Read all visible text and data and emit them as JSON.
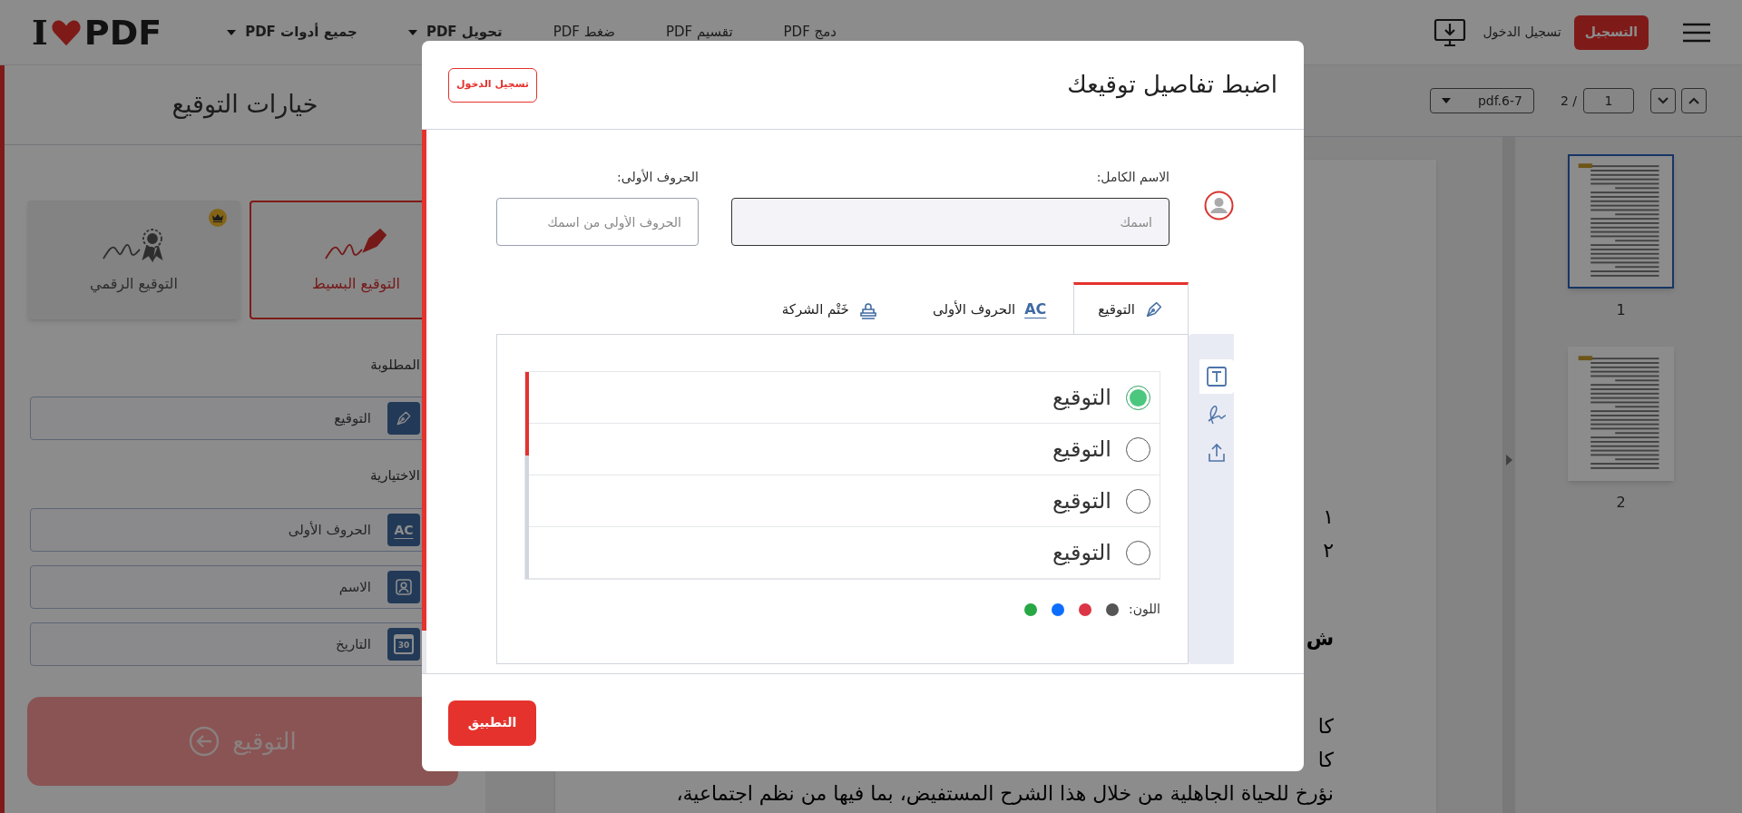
{
  "navbar": {
    "logo": {
      "letter": "I",
      "word": "PDF"
    },
    "nav_items": [
      {
        "label": "دمج PDF",
        "dropdown": false
      },
      {
        "label": "تقسيم PDF",
        "dropdown": false
      },
      {
        "label": "ضغط PDF",
        "dropdown": false
      },
      {
        "label": "تحويل PDF",
        "dropdown": true
      },
      {
        "label": "جميع أدوات PDF",
        "dropdown": true
      }
    ],
    "login": "تسجيل الدخول",
    "signup": "التسجيل"
  },
  "sidebar": {
    "title": "خيارات التوقيع",
    "types": [
      {
        "label": "التوقيع البسيط",
        "kind": "simple",
        "selected": true
      },
      {
        "label": "التوقيع الرقمي",
        "kind": "digital",
        "selected": false
      }
    ],
    "required_heading": "المطلوبة",
    "required_fields": [
      {
        "label": "التوقيع",
        "kind": "pen"
      }
    ],
    "optional_heading": "الاختيارية",
    "optional_fields": [
      {
        "label": "الحروف الأولى",
        "kind": "initials",
        "icon_text": "AC"
      },
      {
        "label": "الاسم",
        "kind": "person"
      },
      {
        "label": "التاريخ",
        "kind": "calendar",
        "icon_text": "30"
      }
    ],
    "sign_button": "التوقيع"
  },
  "viewer": {
    "file": "pdf.6-7",
    "page": "1",
    "page_count": "2 /",
    "document_lines": [
      {
        "text": "١",
        "bold": false
      },
      {
        "text": "٢",
        "bold": false
      },
      {
        "text": "ش",
        "bold": true
      },
      {
        "text": "كا",
        "bold": false
      },
      {
        "text": "كا",
        "bold": false
      },
      {
        "text": "نؤرخ للحياة الجاهلية من خلال هذا الشرح المستفيض، بما فيها من نظم اجتماعية،",
        "bold": false
      }
    ],
    "thumbnails": [
      {
        "label": "1",
        "selected": true
      },
      {
        "label": "2",
        "selected": false
      }
    ]
  },
  "modal": {
    "title": "اضبط تفاصيل توقيعك",
    "login_button": "تسجيل الدخول",
    "full_name": {
      "label": "الاسم الكامل:",
      "placeholder": "اسمك"
    },
    "initials": {
      "label": "الحروف الأولى:",
      "placeholder": "الحروف الأولى من اسمك"
    },
    "tabs": [
      {
        "label": "التوقيع",
        "kind": "pen",
        "selected": true
      },
      {
        "label": "الحروف الأولى",
        "kind": "initials",
        "icon_text": "AC",
        "selected": false
      },
      {
        "label": "خَتْم الشركة",
        "kind": "stamp",
        "selected": false
      }
    ],
    "tools": [
      {
        "kind": "text",
        "selected": true
      },
      {
        "kind": "draw",
        "selected": false
      },
      {
        "kind": "upload",
        "selected": false
      }
    ],
    "options": [
      {
        "label": "التوقيع",
        "selected": true
      },
      {
        "label": "التوقيع",
        "selected": false
      },
      {
        "label": "التوقيع",
        "selected": false
      },
      {
        "label": "التوقيع",
        "selected": false
      }
    ],
    "color_label": "اللون:",
    "colors": [
      {
        "color": "#555555"
      },
      {
        "color": "#dc3545"
      },
      {
        "color": "#0d6efd"
      },
      {
        "color": "#28a745"
      }
    ],
    "apply_button": "التطبيق"
  }
}
